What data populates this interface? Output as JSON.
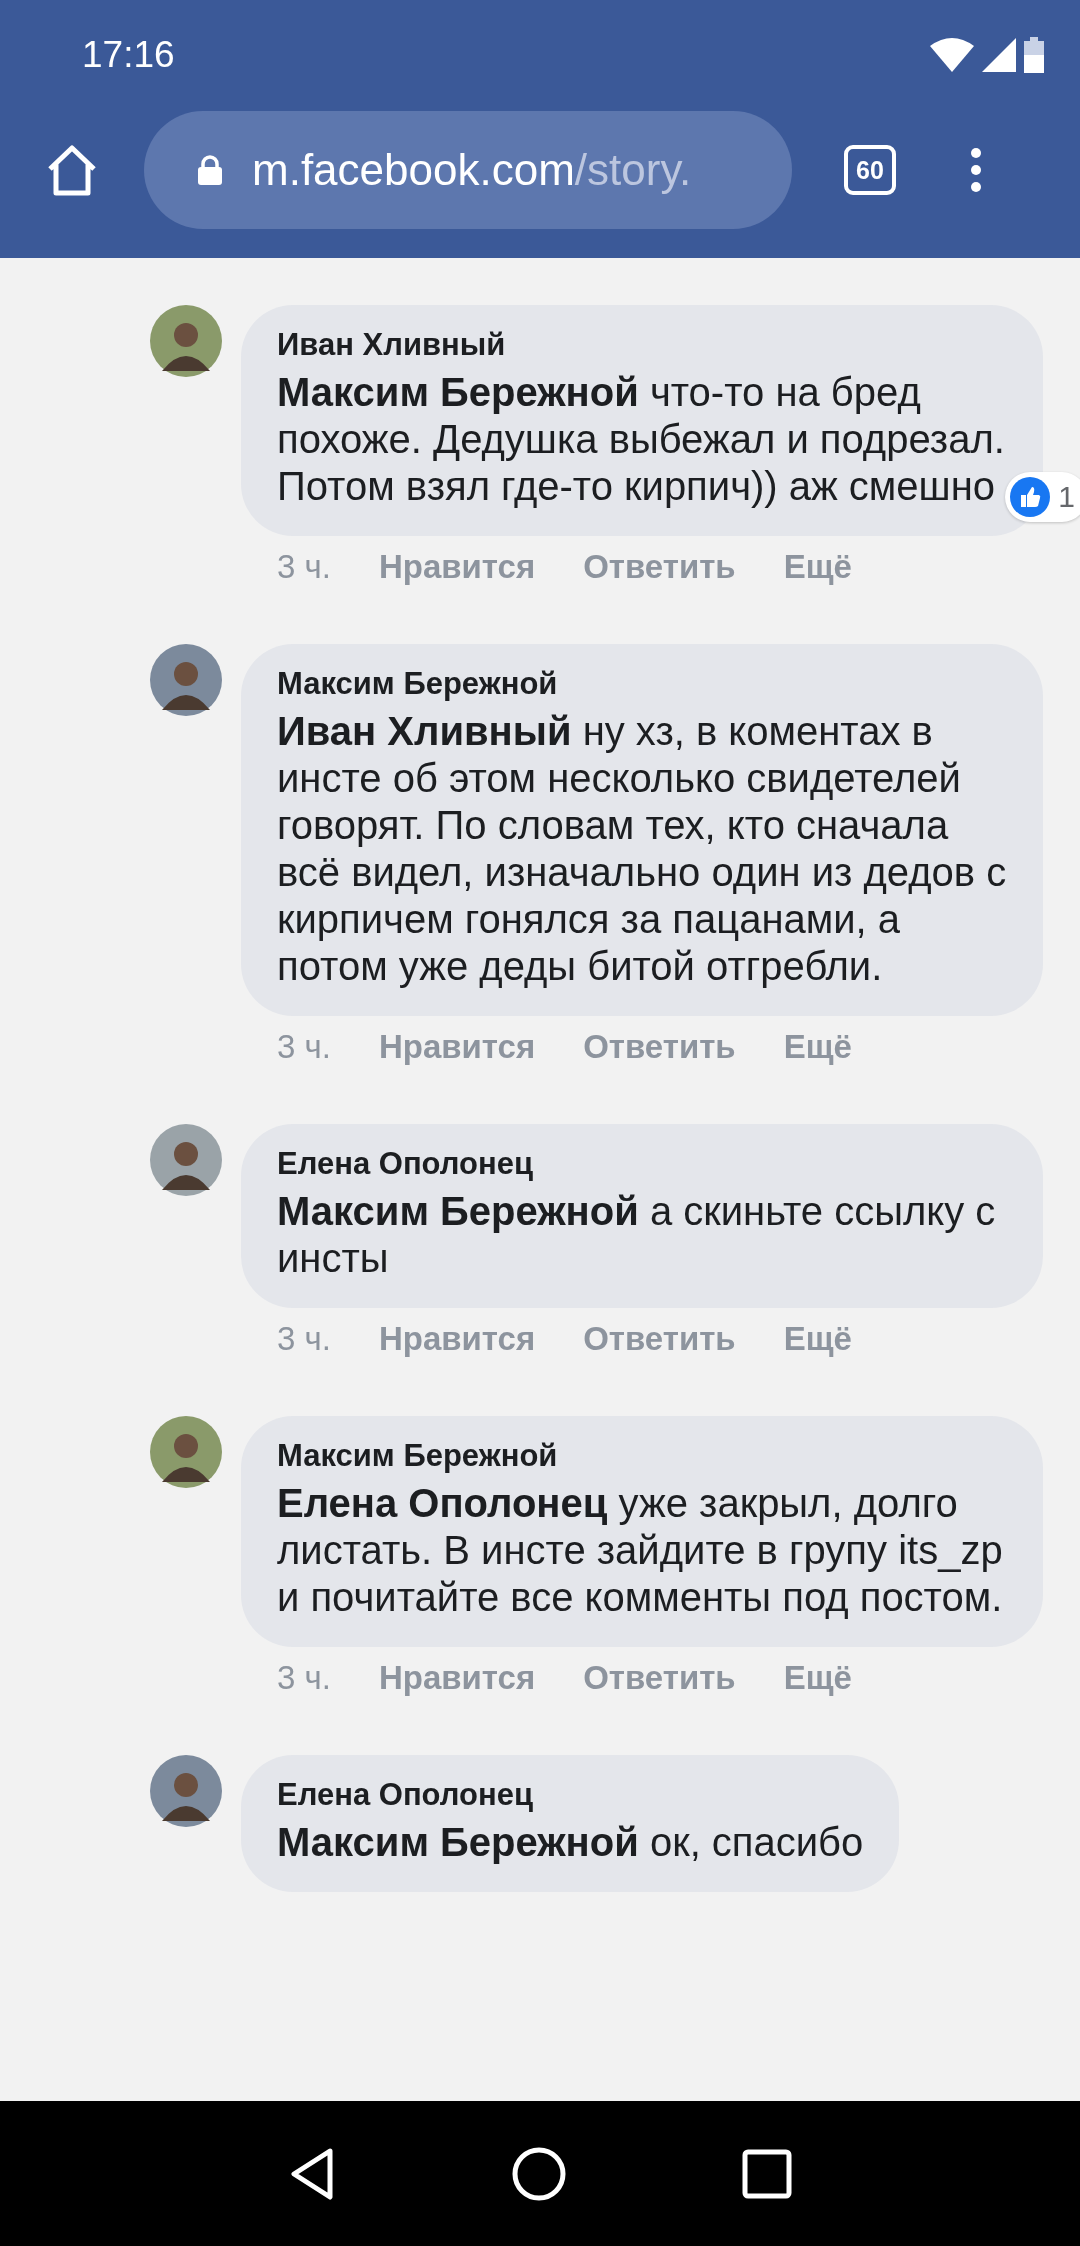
{
  "status_bar": {
    "time": "17:16"
  },
  "browser": {
    "url_host": "m.facebook.com",
    "url_path": "/story.",
    "tab_count": "60"
  },
  "comments": [
    {
      "author": "Иван Хливный",
      "text": "**Максим Бережной** что-то на бред похоже. Дедушка выбежал и подрезал. Потом взял где-то кирпич)) аж смешно",
      "time": "3 ч.",
      "actions": [
        "Нравится",
        "Ответить",
        "Ещё"
      ],
      "reaction_count": "1"
    },
    {
      "author": "Максим Бережной",
      "text": "**Иван Хливный** ну хз, в коментах в инсте об этом несколько свидетелей говорят. По словам тех, кто сначала всё видел, изначально один из дедов с кирпичем гонялся за пацанами, а потом уже деды битой отгребли.",
      "time": "3 ч.",
      "actions": [
        "Нравится",
        "Ответить",
        "Ещё"
      ]
    },
    {
      "author": "Елена Ополонец",
      "text": "**Максим Бережной** а скиньте ссылку с инсты",
      "time": "3 ч.",
      "actions": [
        "Нравится",
        "Ответить",
        "Ещё"
      ]
    },
    {
      "author": "Максим Бережной",
      "text": "**Елена Ополонец** уже закрыл, долго листать. В инсте зайдите в групу its_zp и почитайте все комменты под постом.",
      "time": "3 ч.",
      "actions": [
        "Нравится",
        "Ответить",
        "Ещё"
      ]
    },
    {
      "author": "Елена Ополонец",
      "text": "**Максим Бережной** ок, спасибо"
    }
  ]
}
